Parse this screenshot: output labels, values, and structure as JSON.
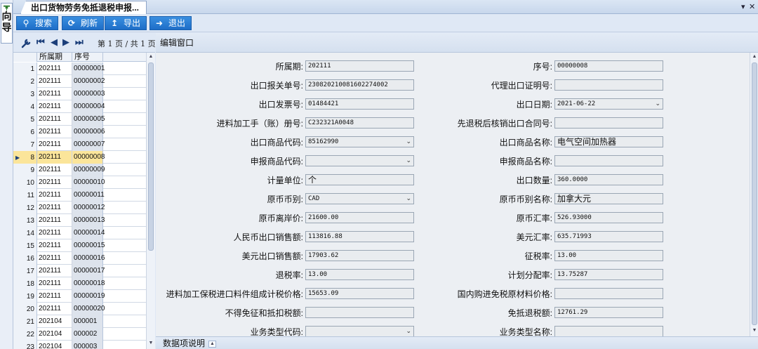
{
  "side_panel": {
    "text": "向导"
  },
  "tab": {
    "title": "出口货物劳务免抵退税申报...",
    "menu_glyph": "▾",
    "close_glyph": "✕"
  },
  "toolbar": {
    "search": "搜索",
    "refresh": "刷新",
    "export": "导出",
    "exit": "退出",
    "icons": [
      "search-icon",
      "refresh-icon",
      "export-icon",
      "exit-icon"
    ]
  },
  "pager": {
    "text": "第 1 页 / 共 1 页"
  },
  "grid": {
    "headers": [
      "所属期",
      "序号"
    ],
    "selected_index": 7,
    "rows": [
      {
        "n": "1",
        "period": "202111",
        "seq": "00000001"
      },
      {
        "n": "2",
        "period": "202111",
        "seq": "00000002"
      },
      {
        "n": "3",
        "period": "202111",
        "seq": "00000003"
      },
      {
        "n": "4",
        "period": "202111",
        "seq": "00000004"
      },
      {
        "n": "5",
        "period": "202111",
        "seq": "00000005"
      },
      {
        "n": "6",
        "period": "202111",
        "seq": "00000006"
      },
      {
        "n": "7",
        "period": "202111",
        "seq": "00000007"
      },
      {
        "n": "8",
        "period": "202111",
        "seq": "00000008"
      },
      {
        "n": "9",
        "period": "202111",
        "seq": "00000009"
      },
      {
        "n": "10",
        "period": "202111",
        "seq": "00000010"
      },
      {
        "n": "11",
        "period": "202111",
        "seq": "00000011"
      },
      {
        "n": "12",
        "period": "202111",
        "seq": "00000012"
      },
      {
        "n": "13",
        "period": "202111",
        "seq": "00000013"
      },
      {
        "n": "14",
        "period": "202111",
        "seq": "00000014"
      },
      {
        "n": "15",
        "period": "202111",
        "seq": "00000015"
      },
      {
        "n": "16",
        "period": "202111",
        "seq": "00000016"
      },
      {
        "n": "17",
        "period": "202111",
        "seq": "00000017"
      },
      {
        "n": "18",
        "period": "202111",
        "seq": "00000018"
      },
      {
        "n": "19",
        "period": "202111",
        "seq": "00000019"
      },
      {
        "n": "20",
        "period": "202111",
        "seq": "00000020"
      },
      {
        "n": "21",
        "period": "202104",
        "seq": "000001"
      },
      {
        "n": "22",
        "period": "202104",
        "seq": "000002"
      },
      {
        "n": "23",
        "period": "202104",
        "seq": "000003"
      }
    ]
  },
  "edit": {
    "title": "编辑窗口",
    "footer": "数据项说明",
    "fields": [
      {
        "label": "所属期:",
        "value": "202111",
        "dropdown": false,
        "font": "mono"
      },
      {
        "label": "序号:",
        "value": "00000008",
        "dropdown": false,
        "font": "mono"
      },
      {
        "label": "出口报关单号:",
        "value": "230820210081602274002",
        "dropdown": false,
        "font": "mono"
      },
      {
        "label": "代理出口证明号:",
        "value": "",
        "dropdown": false,
        "font": "mono"
      },
      {
        "label": "出口发票号:",
        "value": "01484421",
        "dropdown": false,
        "font": "mono"
      },
      {
        "label": "出口日期:",
        "value": "2021-06-22",
        "dropdown": true,
        "font": "mono"
      },
      {
        "label": "进料加工手（账）册号:",
        "value": "C232321A0048",
        "dropdown": false,
        "font": "mono"
      },
      {
        "label": "先退税后核销出口合同号:",
        "value": "",
        "dropdown": false,
        "font": "mono"
      },
      {
        "label": "出口商品代码:",
        "value": "85162990",
        "dropdown": true,
        "font": "mono"
      },
      {
        "label": "出口商品名称:",
        "value": "电气空间加热器",
        "dropdown": false,
        "font": "cn"
      },
      {
        "label": "申报商品代码:",
        "value": "",
        "dropdown": true,
        "font": "mono"
      },
      {
        "label": "申报商品名称:",
        "value": "",
        "dropdown": false,
        "font": "mono"
      },
      {
        "label": "计量单位:",
        "value": "个",
        "dropdown": false,
        "font": "cn"
      },
      {
        "label": "出口数量:",
        "value": "360.0000",
        "dropdown": false,
        "font": "mono"
      },
      {
        "label": "原币币别:",
        "value": "CAD",
        "dropdown": true,
        "font": "mono"
      },
      {
        "label": "原币币别名称:",
        "value": "加拿大元",
        "dropdown": false,
        "font": "cn"
      },
      {
        "label": "原币离岸价:",
        "value": "21600.00",
        "dropdown": false,
        "font": "mono"
      },
      {
        "label": "原币汇率:",
        "value": "526.93000",
        "dropdown": false,
        "font": "mono"
      },
      {
        "label": "人民币出口销售额:",
        "value": "113816.88",
        "dropdown": false,
        "font": "mono"
      },
      {
        "label": "美元汇率:",
        "value": "635.71993",
        "dropdown": false,
        "font": "mono"
      },
      {
        "label": "美元出口销售额:",
        "value": "17903.62",
        "dropdown": false,
        "font": "mono"
      },
      {
        "label": "征税率:",
        "value": "13.00",
        "dropdown": false,
        "font": "mono"
      },
      {
        "label": "退税率:",
        "value": "13.00",
        "dropdown": false,
        "font": "mono"
      },
      {
        "label": "计划分配率:",
        "value": "13.75287",
        "dropdown": false,
        "font": "mono"
      },
      {
        "label": "进料加工保税进口料件组成计税价格:",
        "value": "15653.09",
        "dropdown": false,
        "font": "mono"
      },
      {
        "label": "国内购进免税原材料价格:",
        "value": "",
        "dropdown": false,
        "font": "mono"
      },
      {
        "label": "不得免征和抵扣税额:",
        "value": "",
        "dropdown": false,
        "font": "mono"
      },
      {
        "label": "免抵退税额:",
        "value": "12761.29",
        "dropdown": false,
        "font": "mono"
      },
      {
        "label": "业务类型代码:",
        "value": "",
        "dropdown": true,
        "font": "mono"
      },
      {
        "label": "业务类型名称:",
        "value": "",
        "dropdown": false,
        "font": "mono"
      }
    ]
  }
}
